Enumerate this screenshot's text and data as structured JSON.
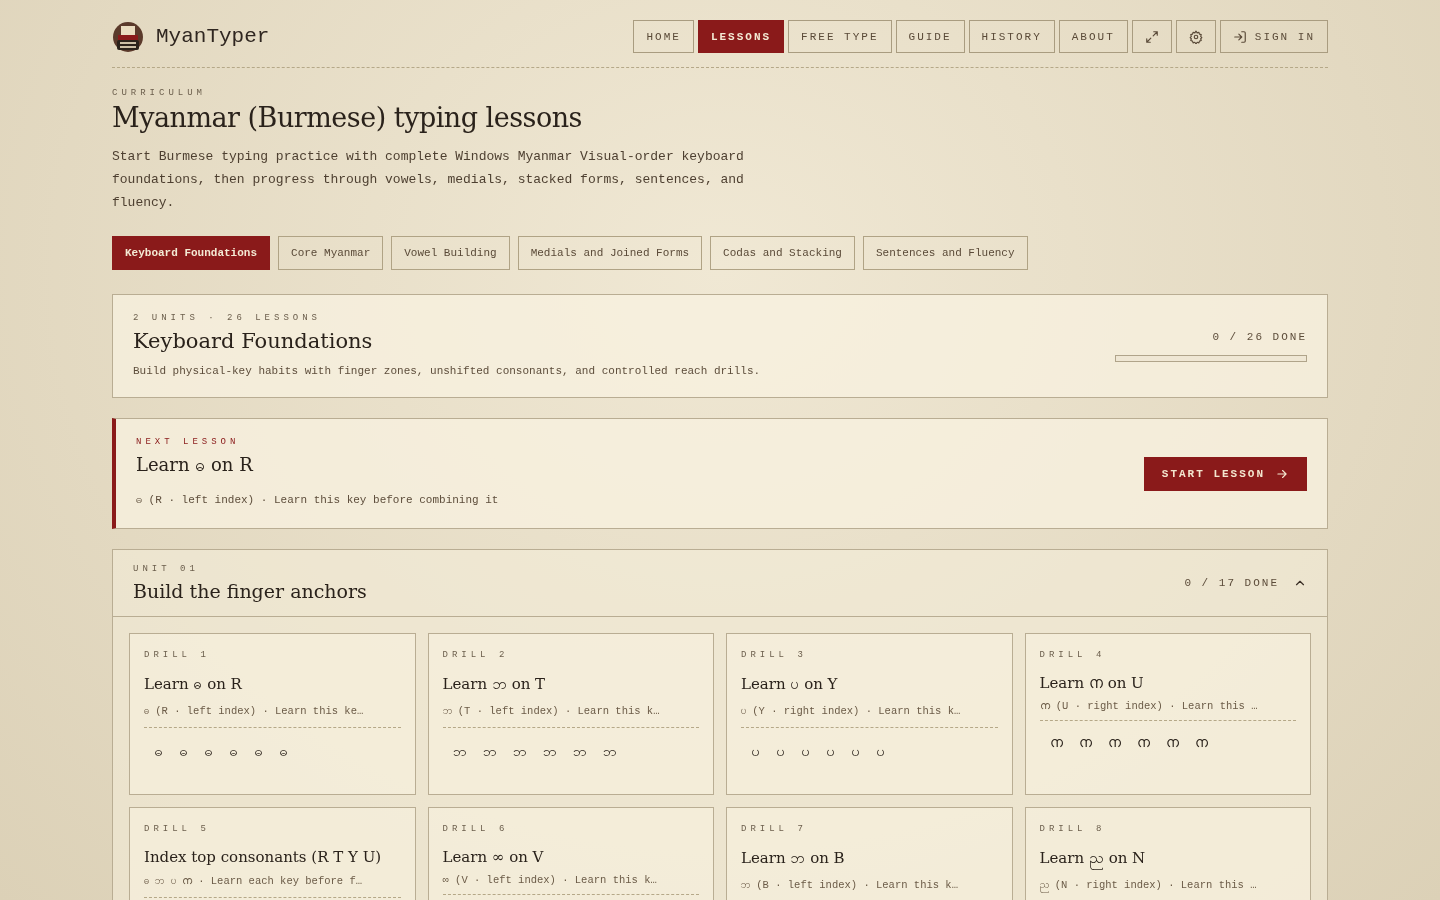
{
  "brand": {
    "name": "MyanTyper"
  },
  "nav": [
    {
      "kind": "text",
      "label": "HOME",
      "selected": false
    },
    {
      "kind": "text",
      "label": "LESSONS",
      "selected": true
    },
    {
      "kind": "text",
      "label": "FREE TYPE",
      "selected": false
    },
    {
      "kind": "text",
      "label": "GUIDE",
      "selected": false
    },
    {
      "kind": "text",
      "label": "HISTORY",
      "selected": false
    },
    {
      "kind": "text",
      "label": "ABOUT",
      "selected": false
    },
    {
      "kind": "fullscreen",
      "selected": false
    },
    {
      "kind": "settings",
      "selected": false
    },
    {
      "kind": "signin",
      "label": "SIGN IN",
      "selected": false
    }
  ],
  "header": {
    "eyebrow": "CURRICULUM",
    "title": "Myanmar (Burmese) typing lessons",
    "intro": "Start Burmese typing practice with complete Windows Myanmar Visual-order keyboard foundations, then progress through vowels, medials, stacked forms, sentences, and fluency."
  },
  "tabs": [
    {
      "label": "Keyboard Foundations",
      "selected": true
    },
    {
      "label": "Core Myanmar",
      "selected": false
    },
    {
      "label": "Vowel Building",
      "selected": false
    },
    {
      "label": "Medials and Joined Forms",
      "selected": false
    },
    {
      "label": "Codas and Stacking",
      "selected": false
    },
    {
      "label": "Sentences and Fluency",
      "selected": false
    }
  ],
  "course": {
    "meta": "2 UNITS · 26 LESSONS",
    "title": "Keyboard Foundations",
    "description": "Build physical-key habits with finger zones, unshifted consonants, and controlled reach drills.",
    "progress_text": "0 / 26 DONE",
    "level": 0
  },
  "next_lesson": {
    "eyebrow": "NEXT LESSON",
    "title": "Learn ဓ on R",
    "detail": "ဓ (R · left index) · Learn this key before combining it",
    "button": "START LESSON"
  },
  "unit": {
    "eyebrow": "UNIT 01",
    "title": "Build the finger anchors",
    "progress_text": "0 / 17 DONE",
    "expanded": true,
    "drills": [
      {
        "label": "DRILL 1",
        "title": "Learn ဓ on R",
        "detail": "ဓ (R · left index) · Learn this ke…",
        "keys": [
          "ဓ",
          "ဓ",
          "ဓ",
          "ဓ",
          "ဓ",
          "ဓ"
        ]
      },
      {
        "label": "DRILL 2",
        "title": "Learn ဘ on T",
        "detail": "ဘ (T · left index) · Learn this k…",
        "keys": [
          "ဘ",
          "ဘ",
          "ဘ",
          "ဘ",
          "ဘ",
          "ဘ"
        ]
      },
      {
        "label": "DRILL 3",
        "title": "Learn ပ on Y",
        "detail": "ပ (Y · right index) · Learn this k…",
        "keys": [
          "ပ",
          "ပ",
          "ပ",
          "ပ",
          "ပ",
          "ပ"
        ]
      },
      {
        "label": "DRILL 4",
        "title": "Learn ന on U",
        "detail": "ന (U · right index) · Learn this …",
        "keys": [
          "ന",
          "ന",
          "ന",
          "ന",
          "ന",
          "ന"
        ]
      },
      {
        "label": "DRILL 5",
        "title": "Index top consonants (R T Y U)",
        "detail": "ဓ ဘ ပ ന · Learn each key before f…"
      },
      {
        "label": "DRILL 6",
        "title": "Learn ∞ on V",
        "detail": "∞ (V · left index) · Learn this k…"
      },
      {
        "label": "DRILL 7",
        "title": "Learn ဘ on B",
        "detail": "ဘ (B · left index) · Learn this k…"
      },
      {
        "label": "DRILL 8",
        "title": "Learn ည on N",
        "detail": "ည (N · right index) · Learn this …"
      }
    ]
  }
}
